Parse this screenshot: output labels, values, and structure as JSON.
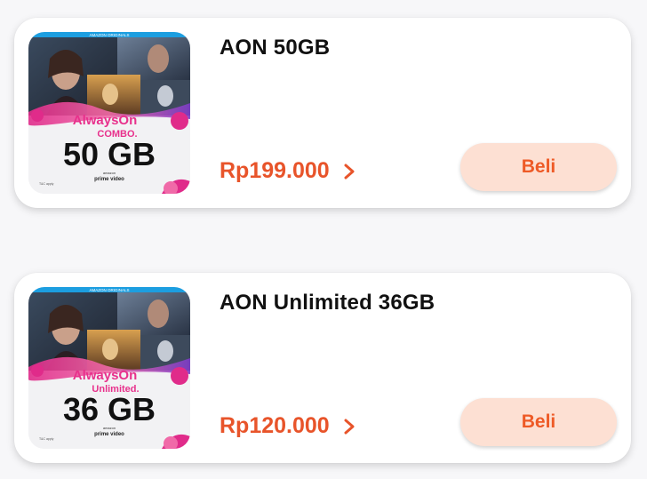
{
  "products": [
    {
      "title": "AON 50GB",
      "price": "Rp199.000",
      "buy_label": "Beli",
      "banner": {
        "brand_top": "AMAZON ORIGINALS",
        "line1": "AlwaysOn",
        "line2": "COMBO.",
        "quota": "50 GB",
        "partner_small": "amazon",
        "partner": "prime video",
        "fine_print": "T&C apply"
      }
    },
    {
      "title": "AON Unlimited 36GB",
      "price": "Rp120.000",
      "buy_label": "Beli",
      "banner": {
        "brand_top": "AMAZON ORIGINALS",
        "line1": "AlwaysOn",
        "line2": "Unlimited.",
        "quota": "36 GB",
        "partner_small": "amazon",
        "partner": "prime video",
        "fine_print": "T&C apply"
      }
    }
  ],
  "colors": {
    "price": "#e8542a",
    "button_bg": "#fde0d3",
    "button_text": "#ee5a26",
    "banner_pink": "#e8318c",
    "banner_top_bar": "#1c9ee0"
  },
  "icons": {
    "price_arrow": "chevron-right-icon"
  }
}
